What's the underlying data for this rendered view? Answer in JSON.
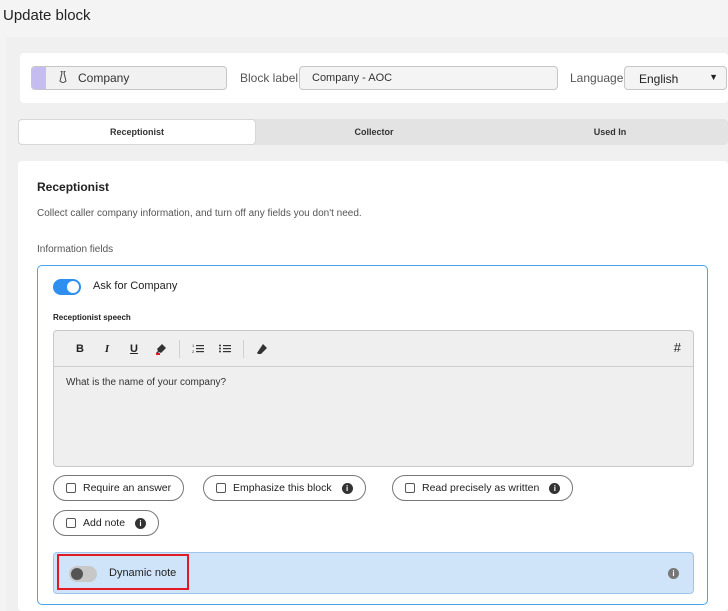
{
  "page": {
    "title": "Update block"
  },
  "header": {
    "block_type": "Company",
    "block_label_caption": "Block label",
    "block_label_value": "Company - AOC",
    "language_caption": "Language",
    "language_value": "English"
  },
  "tabs": [
    {
      "label": "Receptionist",
      "active": true
    },
    {
      "label": "Collector",
      "active": false
    },
    {
      "label": "Used In",
      "active": false
    }
  ],
  "section": {
    "title": "Receptionist",
    "description": "Collect caller company information, and turn off any fields you don't need.",
    "info_fields_label": "Information fields"
  },
  "field": {
    "ask_label": "Ask for Company",
    "ask_enabled": true,
    "speech_label": "Receptionist speech",
    "toolbar": {
      "bold": "B",
      "italic": "I",
      "underline": "U",
      "hash": "#"
    },
    "speech_text": "What is the name of your company?",
    "options": {
      "require_answer": "Require an answer",
      "emphasize": "Emphasize this block",
      "read_precisely": "Read precisely as written",
      "add_note": "Add note"
    },
    "dynamic_note_label": "Dynamic note",
    "dynamic_note_enabled": false
  },
  "colors": {
    "accent": "#2f8ff0",
    "highlight": "#e01b24",
    "block_stripe": "#c5bdf0"
  }
}
